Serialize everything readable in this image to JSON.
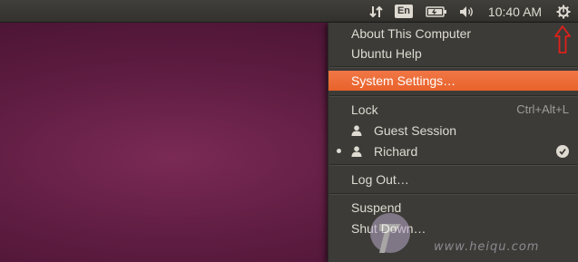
{
  "panel": {
    "network_icon": "transfer-arrows-icon",
    "keyboard_layout": "En",
    "battery_icon": "battery-icon",
    "volume_icon": "volume-icon",
    "clock": "10:40 AM",
    "session_icon": "gear-power-icon"
  },
  "menu": {
    "about": "About This Computer",
    "help": "Ubuntu Help",
    "system_settings": "System Settings…",
    "lock": "Lock",
    "lock_shortcut": "Ctrl+Alt+L",
    "guest": "Guest Session",
    "user": "Richard",
    "logout": "Log Out…",
    "suspend": "Suspend",
    "shutdown": "Shut Down…"
  },
  "colors": {
    "highlight": "#e9622b",
    "menu_bg": "#3c3b37",
    "annotation": "#e0201a"
  },
  "watermark": {
    "url": "www.heiqu.com"
  }
}
